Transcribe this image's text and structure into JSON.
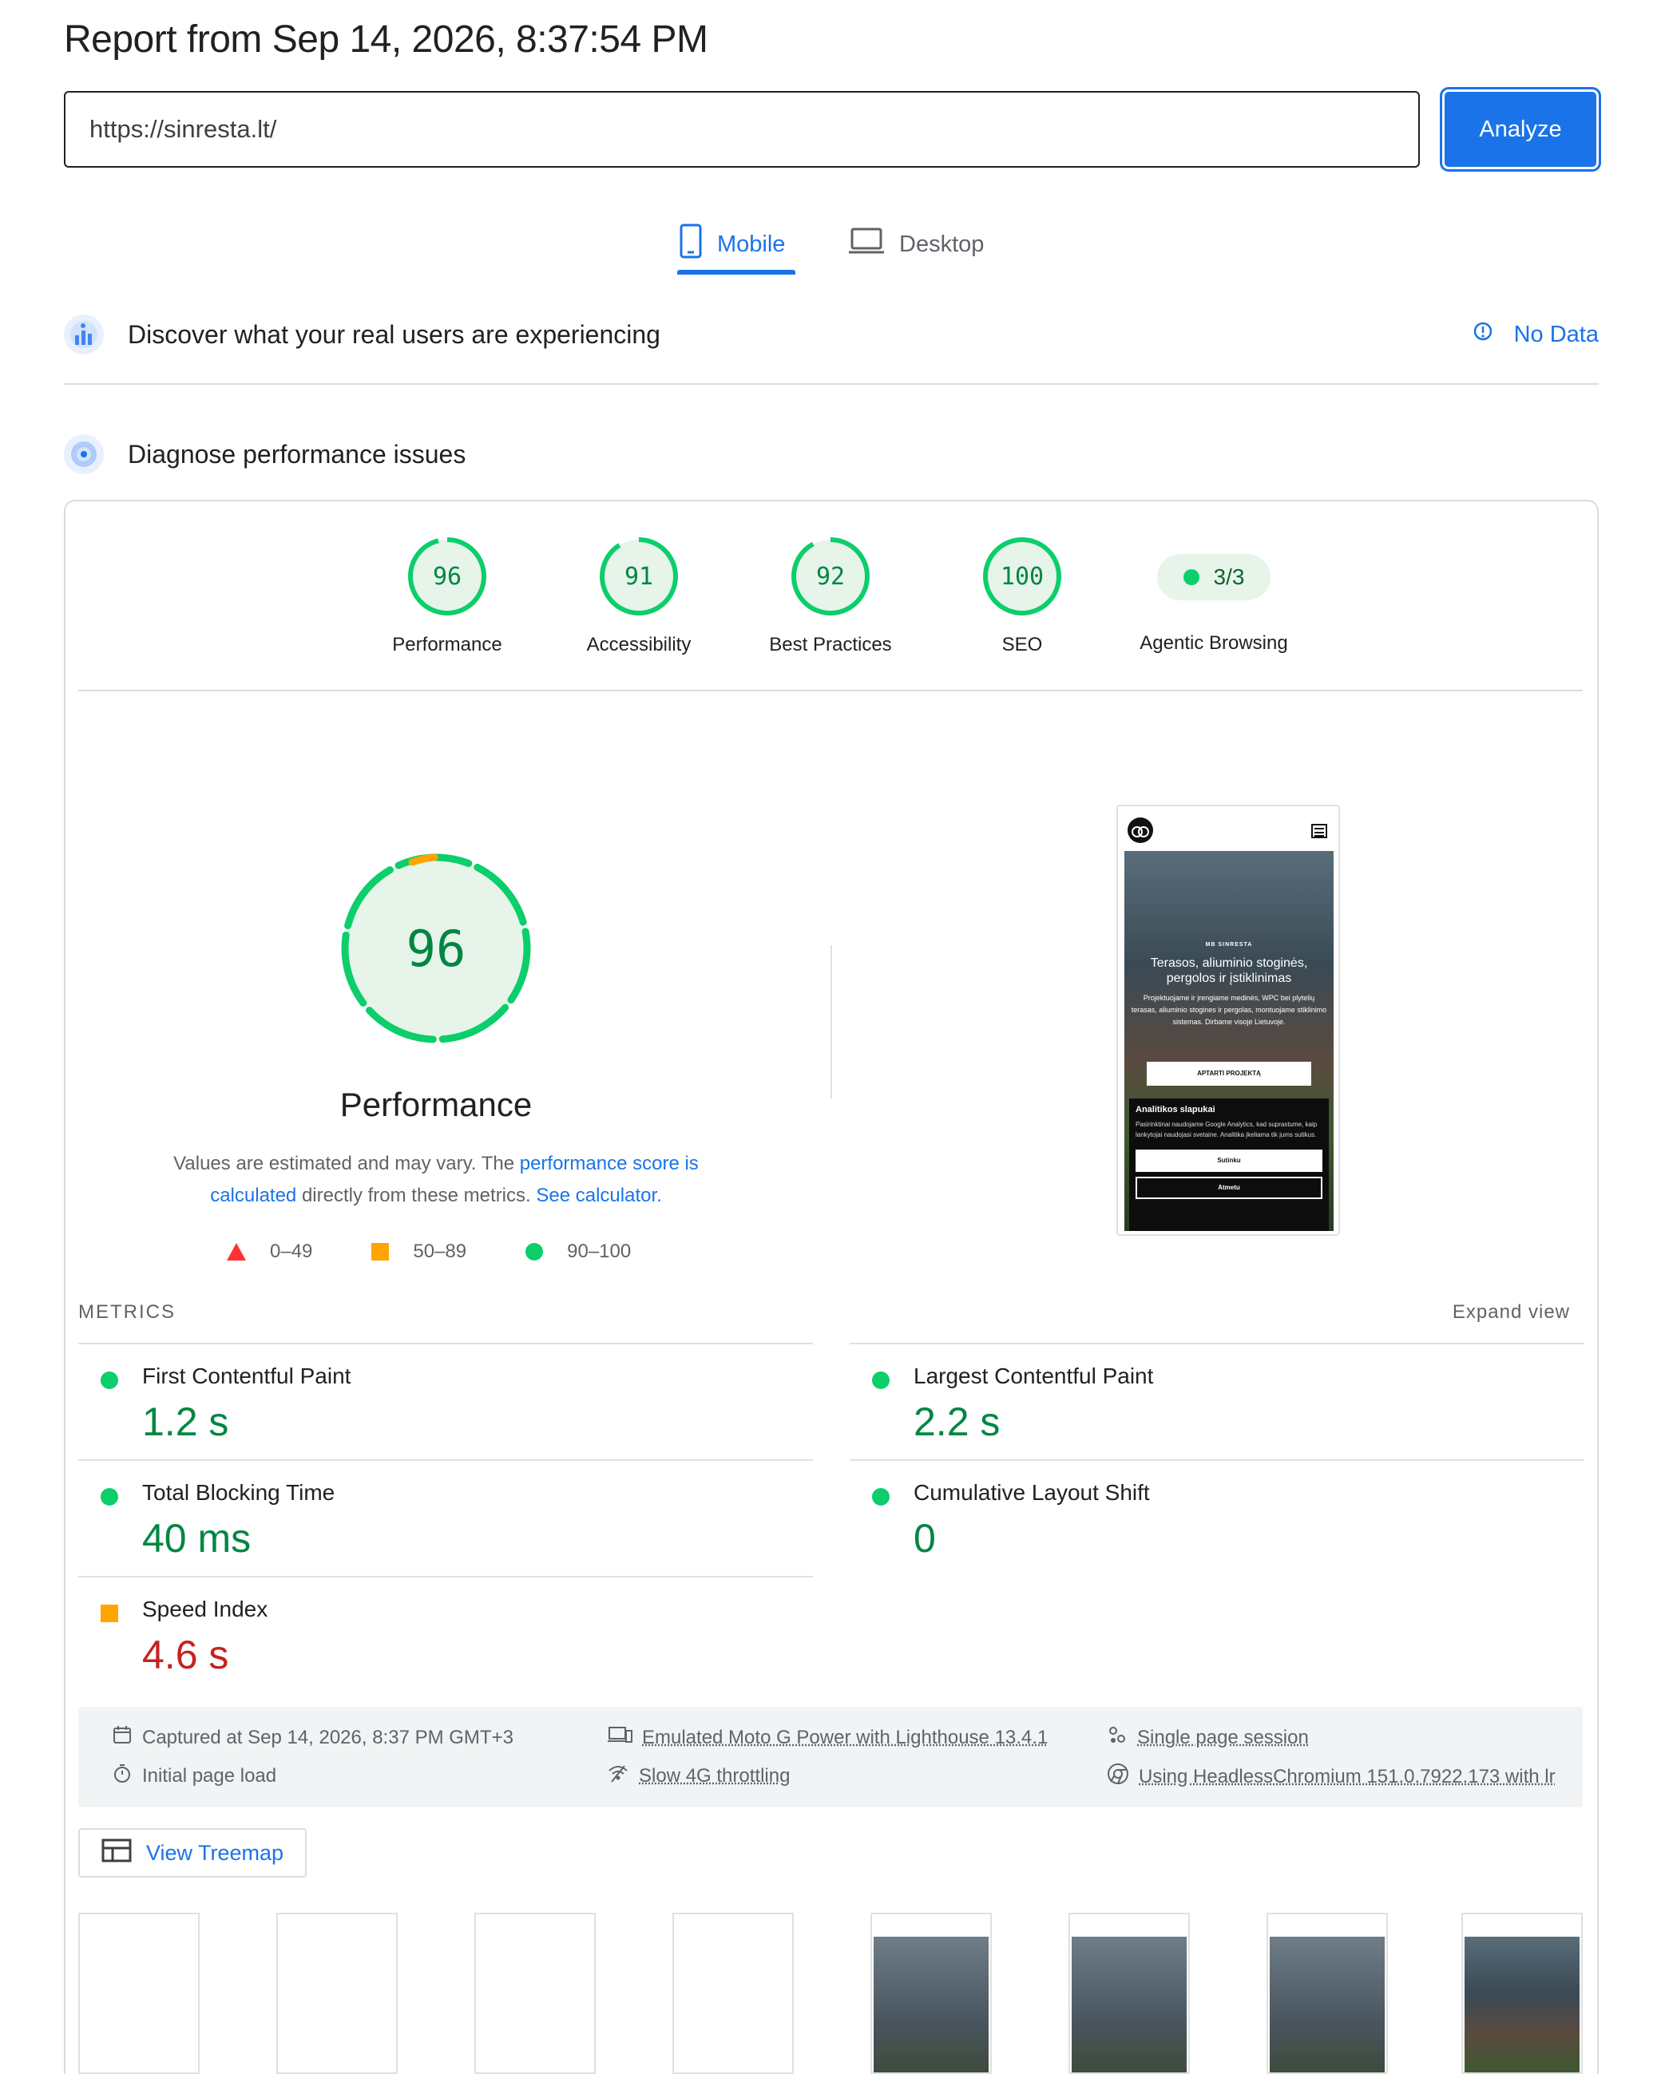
{
  "report": {
    "title": "Report from Sep 14, 2026, 8:37:54 PM",
    "url_value": "https://sinresta.lt/",
    "analyze_label": "Analyze"
  },
  "tabs": [
    {
      "label": "Mobile",
      "active": true
    },
    {
      "label": "Desktop",
      "active": false
    }
  ],
  "sections": {
    "field_data": {
      "text": "Discover what your real users are experiencing",
      "status": "No Data"
    },
    "lab": {
      "text": "Diagnose performance issues"
    }
  },
  "category_scores": [
    {
      "label": "Performance",
      "score": "96",
      "fraction": 0.96
    },
    {
      "label": "Accessibility",
      "score": "91",
      "fraction": 0.91
    },
    {
      "label": "Best Practices",
      "score": "92",
      "fraction": 0.92
    },
    {
      "label": "SEO",
      "score": "100",
      "fraction": 1.0
    },
    {
      "label": "Agentic Browsing",
      "score": "3/3"
    }
  ],
  "performance": {
    "score": "96",
    "title": "Performance",
    "desc_prefix": "Values are estimated and may vary. The ",
    "desc_link1": "performance score is calculated",
    "desc_middle": " directly from these metrics. ",
    "desc_link2": "See calculator."
  },
  "legend": [
    {
      "range": "0–49",
      "shape": "triangle",
      "color": "#ff3333"
    },
    {
      "range": "50–89",
      "shape": "square",
      "color": "#ffa400"
    },
    {
      "range": "90–100",
      "shape": "circle",
      "color": "#0cce6b"
    }
  ],
  "metrics": {
    "header": "METRICS",
    "expand": "Expand view",
    "items": [
      {
        "name": "First Contentful Paint",
        "value": "1.2 s",
        "rating": "good"
      },
      {
        "name": "Largest Contentful Paint",
        "value": "2.2 s",
        "rating": "good"
      },
      {
        "name": "Total Blocking Time",
        "value": "40 ms",
        "rating": "good"
      },
      {
        "name": "Cumulative Layout Shift",
        "value": "0",
        "rating": "good"
      },
      {
        "name": "Speed Index",
        "value": "4.6 s",
        "rating": "average"
      }
    ]
  },
  "runtime": {
    "captured": "Captured at Sep 14, 2026, 8:37 PM GMT+3",
    "initial_load": "Initial page load",
    "device": "Emulated Moto G Power with Lighthouse 13.4.1",
    "throttling": "Slow 4G throttling",
    "session": "Single page session",
    "browser": "Using HeadlessChromium 151.0.7922.173 with lr"
  },
  "treemap_label": "View Treemap",
  "screenshot": {
    "brand": "MB SINRESTA",
    "headline": "Terasos, aliuminio stoginės, pergolos ir įstiklinimas",
    "body": "Projektuojame ir įrengiame medinės, WPC bei plytelių terasas, aliuminio stogines ir pergolas, montuojame stiklinimo sistemas. Dirbame visoje Lietuvoje.",
    "cta": "APTARTI PROJEKTĄ",
    "cookie_title": "Analitikos slapukai",
    "cookie_body": "Pasirinktinai naudojame Google Analytics, kad suprastume, kaip lankytojai naudojasi svetaine. Analitika įkeliama tik jums sutikus.",
    "accept": "Sutinku",
    "reject": "Atmetu"
  },
  "colors": {
    "accent": "#1a73e8",
    "pass": "#0cce6b",
    "pass_text": "#018642",
    "average": "#ffa400",
    "fail_text": "#c5221f"
  }
}
